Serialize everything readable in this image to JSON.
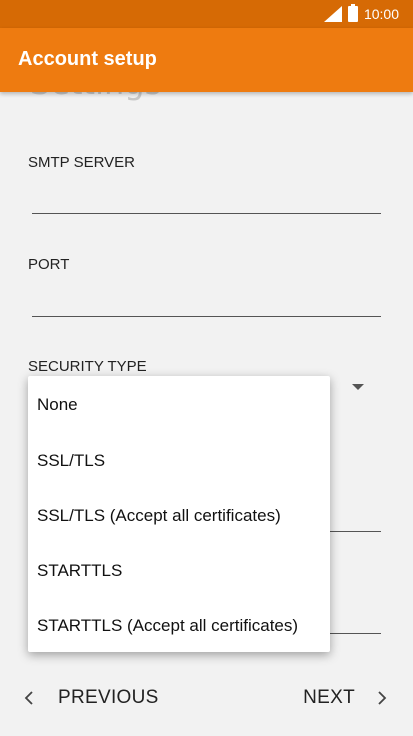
{
  "status_bar": {
    "time": "10:00"
  },
  "app_bar": {
    "title": "Account setup"
  },
  "form": {
    "section_heading": "Settings",
    "smtp_server": {
      "label": "SMTP SERVER",
      "value": ""
    },
    "port": {
      "label": "PORT",
      "value": ""
    },
    "security_type": {
      "label": "SECURITY TYPE"
    }
  },
  "dropdown": {
    "options": [
      "None",
      "SSL/TLS",
      "SSL/TLS (Accept all certificates)",
      "STARTTLS",
      "STARTTLS (Accept all certificates)"
    ]
  },
  "navigation": {
    "previous_label": "PREVIOUS",
    "next_label": "NEXT"
  },
  "colors": {
    "status_bar": "#d66a05",
    "app_bar": "#ee7b10",
    "background": "#f2f2f2"
  },
  "icons": {
    "signal": "signal-icon",
    "battery": "battery-icon",
    "previous": "chevron-left-icon",
    "next": "chevron-right-icon",
    "dropdown": "dropdown-arrow-icon"
  }
}
